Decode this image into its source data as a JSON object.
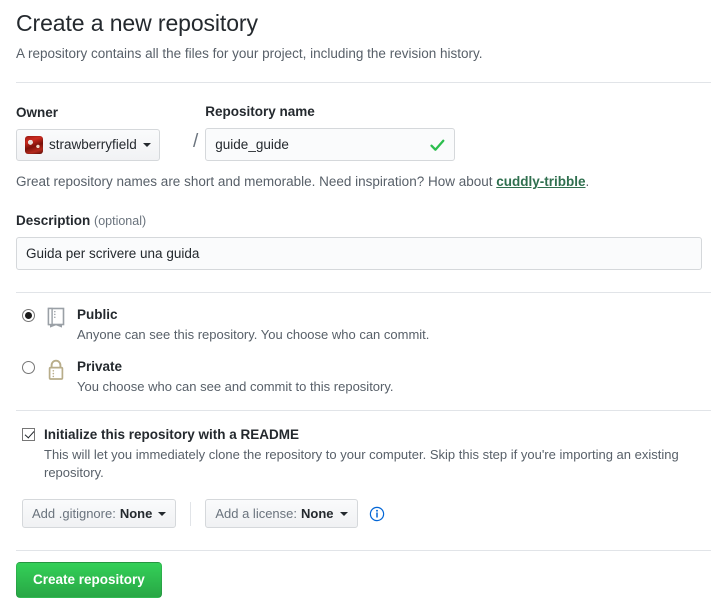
{
  "header": {
    "title": "Create a new repository",
    "subtitle": "A repository contains all the files for your project, including the revision history."
  },
  "owner": {
    "label": "Owner",
    "name": "strawberryfield",
    "avatar_icon": "user-avatar",
    "caret_icon": "chevron-down-icon",
    "separator": "/"
  },
  "repository_name": {
    "label": "Repository name",
    "value": "guide_guide",
    "placeholder": "",
    "valid_icon": "check-icon"
  },
  "hint": {
    "text_before": "Great repository names are short and memorable. Need inspiration? How about ",
    "suggestion": "cuddly-tribble",
    "text_after": "."
  },
  "description": {
    "label": "Description",
    "optional_label": "(optional)",
    "value": "Guida per scrivere una guida",
    "placeholder": ""
  },
  "visibility": {
    "options": [
      {
        "id": "public",
        "title": "Public",
        "description": "Anyone can see this repository. You choose who can commit.",
        "icon": "repo-book-icon",
        "selected": true
      },
      {
        "id": "private",
        "title": "Private",
        "description": "You choose who can see and commit to this repository.",
        "icon": "lock-icon",
        "selected": false
      }
    ]
  },
  "readme": {
    "label": "Initialize this repository with a README",
    "description": "This will let you immediately clone the repository to your computer. Skip this step if you're importing an existing repository.",
    "checked": true
  },
  "dropdowns": {
    "gitignore": {
      "label": "Add .gitignore:",
      "value": "None",
      "caret_icon": "chevron-down-icon"
    },
    "license": {
      "label": "Add a license:",
      "value": "None",
      "caret_icon": "chevron-down-icon"
    },
    "info_icon": "info-circle-icon"
  },
  "submit": {
    "label": "Create repository"
  },
  "colors": {
    "accent_green": "#28a745",
    "suggestion_green": "#2f6f4e",
    "info_blue": "#0366d6",
    "lock_tan": "#b8ad8a",
    "border": "#e1e4e8",
    "text": "#24292e",
    "muted_text": "#586069"
  }
}
